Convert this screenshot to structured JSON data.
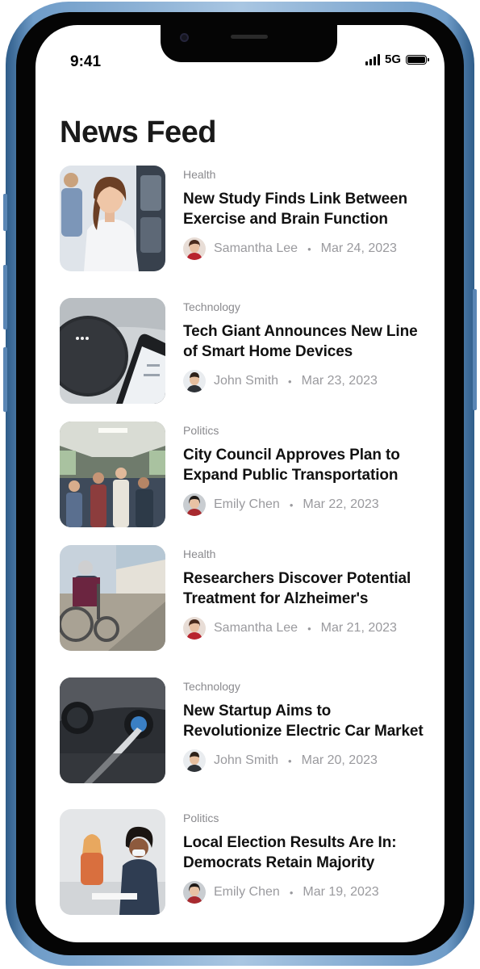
{
  "status_bar": {
    "time": "9:41",
    "network": "5G",
    "icons": [
      "signal-icon",
      "battery-icon"
    ]
  },
  "feed": {
    "title": "News Feed",
    "articles": [
      {
        "category": "Health",
        "headline": "New Study Finds Link Between Exercise and Brain Function",
        "author": "Samantha Lee",
        "date": "Mar 24, 2023"
      },
      {
        "category": "Technology",
        "headline": "Tech Giant Announces New Line of Smart Home Devices",
        "author": "John Smith",
        "date": "Mar 23, 2023"
      },
      {
        "category": "Politics",
        "headline": "City Council Approves Plan to Expand Public Transportation",
        "author": "Emily Chen",
        "date": "Mar 22, 2023"
      },
      {
        "category": "Health",
        "headline": "Researchers Discover Potential Treatment for Alzheimer's",
        "author": "Samantha Lee",
        "date": "Mar 21, 2023"
      },
      {
        "category": "Technology",
        "headline": "New Startup Aims to Revolutionize Electric Car Market",
        "author": "John Smith",
        "date": "Mar 20, 2023"
      },
      {
        "category": "Politics",
        "headline": "Local Election Results Are In: Democrats Retain Majority",
        "author": "Emily Chen",
        "date": "Mar 19, 2023"
      }
    ]
  },
  "colors": {
    "frame": "#6f9cc8",
    "category_text": "#8a8a8e",
    "headline_text": "#111111",
    "meta_text": "#9a9a9e"
  }
}
